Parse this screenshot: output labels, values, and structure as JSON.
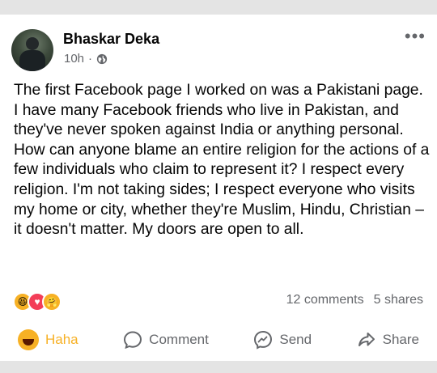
{
  "post": {
    "author": "Bhaskar Deka",
    "time": "10h",
    "separator": "·",
    "privacy_icon": "globe-icon",
    "more_icon": "•••",
    "text": "The first Facebook page I worked on was a Pakistani page. I have many Facebook friends who live in Pakistan, and they've never spoken against India or anything personal. How can anyone blame an entire religion for the actions of a few individuals who claim to represent it? I respect every religion. I'm not taking sides; I respect everyone who visits my home or city, whether they're Muslim, Hindu, Christian – it doesn't matter. My doors are open to all."
  },
  "reactions": {
    "icons": [
      "haha-reaction-icon",
      "love-reaction-icon",
      "care-reaction-icon"
    ],
    "comments": "12 comments",
    "shares": "5 shares"
  },
  "actions": {
    "haha_label": "Haha",
    "comment_label": "Comment",
    "send_label": "Send",
    "share_label": "Share"
  },
  "colors": {
    "active_reaction": "#f7b125",
    "secondary_text": "#65676b",
    "primary_text": "#050505"
  }
}
